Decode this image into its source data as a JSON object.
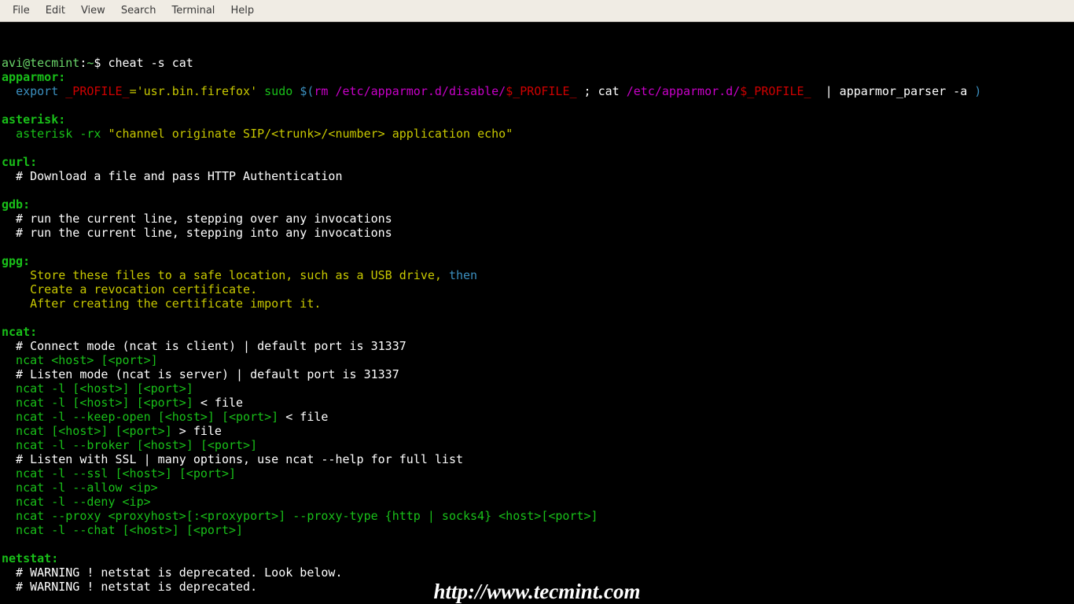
{
  "menu": {
    "items": [
      "File",
      "Edit",
      "View",
      "Search",
      "Terminal",
      "Help"
    ]
  },
  "prompt": {
    "userhost": "avi@tecmint",
    "sep": ":",
    "path": "~",
    "dollar": "$",
    "command": "cheat -s cat"
  },
  "apparmor": {
    "heading": "apparmor:",
    "indent": "  ",
    "export_kw": "export",
    "var1": " _PROFILE_",
    "eq_str": "='usr.bin.firefox'",
    "sudo": " sudo ",
    "subopen": "$(",
    "rm": "rm ",
    "path1": "/etc/apparmor.d/disable/",
    "var2": "$_PROFILE_",
    "semi": " ; cat ",
    "path2": "/etc/apparmor.d/",
    "var3": "$_PROFILE_",
    "pipe": "  | apparmor_parser -a ",
    "subclose": ")"
  },
  "asterisk": {
    "heading": "asterisk:",
    "indent": "  ",
    "cmd": "asterisk -rx ",
    "str": "\"channel originate SIP/<trunk>/<number> application echo\""
  },
  "curl": {
    "heading": "curl:",
    "l1": "  # Download a file and pass HTTP Authentication"
  },
  "gdb": {
    "heading": "gdb:",
    "l1": "  # run the current line, stepping over any invocations",
    "l2": "  # run the current line, stepping into any invocations"
  },
  "gpg": {
    "heading": "gpg:",
    "l1a": "    Store these files to a safe location, such as a USB drive, ",
    "l1b": "then",
    "l2": "    Create a revocation certificate.",
    "l3": "    After creating the certificate import it."
  },
  "ncat": {
    "heading": "ncat:",
    "l1": "  # Connect mode (ncat is client) | default port is 31337",
    "l2": "  ncat <host> [<port>]",
    "l3": "  # Listen mode (ncat is server) | default port is 31337",
    "l4": "  ncat -l [<host>] [<port>]",
    "l5a": "  ncat -l [<host>] [<port>]",
    "l5b": " < file",
    "l6a": "  ncat -l --keep-open [<host>] [<port>]",
    "l6b": " < file",
    "l7a": "  ncat [<host>] [<port>]",
    "l7b": " > file",
    "l8": "  ncat -l --broker [<host>] [<port>]",
    "l9": "  # Listen with SSL | many options, use ncat --help for full list",
    "l10": "  ncat -l --ssl [<host>] [<port>]",
    "l11": "  ncat -l --allow <ip>",
    "l12": "  ncat -l --deny <ip>",
    "l13": "  ncat --proxy <proxyhost>[:<proxyport>] --proxy-type {http | socks4} <host>[<port>]",
    "l14": "  ncat -l --chat [<host>] [<port>]"
  },
  "netstat": {
    "heading": "netstat:",
    "l1": "  # WARNING ! netstat is deprecated. Look below.",
    "l2": "  # WARNING ! netstat is deprecated."
  },
  "watermark": "http://www.tecmint.com"
}
